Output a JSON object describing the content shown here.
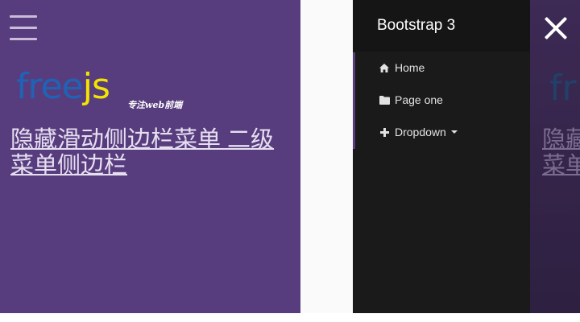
{
  "colors": {
    "page_bg": "#583d7e",
    "sidebar_bg": "#1a1a1a",
    "accent": "#583d7e",
    "logo_blue": "#1f63b6",
    "logo_yellow": "#f2e500"
  },
  "menu_toggle": {
    "icon": "hamburger-icon"
  },
  "logo": {
    "part1": "free",
    "part2": "js",
    "tagline": "专注web前端"
  },
  "page": {
    "title": "隐藏滑动侧边栏菜单 二级菜单侧边栏"
  },
  "sidebar": {
    "brand": "Bootstrap 3",
    "items": [
      {
        "label": "Home",
        "icon": "home-icon"
      },
      {
        "label": "Page one",
        "icon": "folder-icon"
      },
      {
        "label": "Dropdown",
        "icon": "plus-icon",
        "has_caret": true
      }
    ]
  },
  "close": {
    "icon": "close-icon"
  },
  "overlay": {
    "logo_fragment": "fr",
    "title_fragment": "隐藏滑动侧边栏菜单 二级菜单侧边栏"
  }
}
